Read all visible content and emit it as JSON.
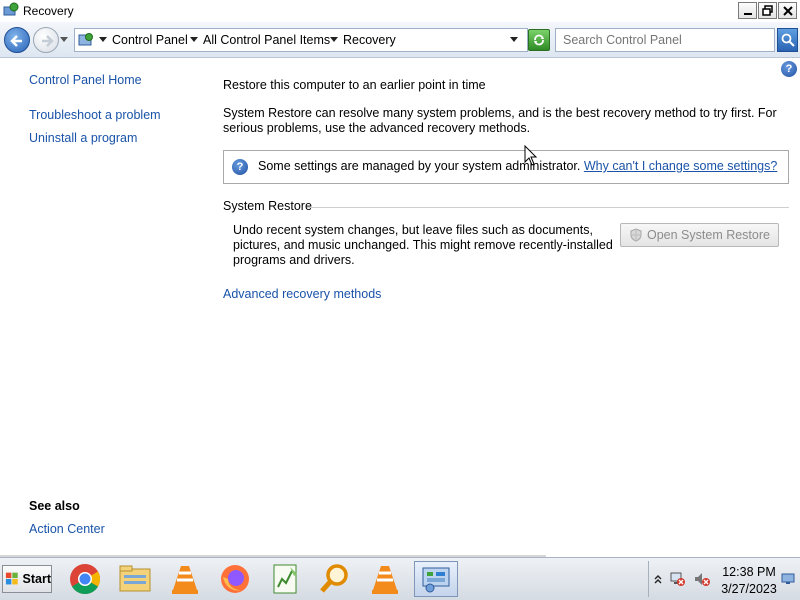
{
  "window": {
    "title": "Recovery",
    "min_glyph": "▁",
    "max_glyph": "❐",
    "close_glyph": "✕"
  },
  "address": {
    "crumbs": [
      "Control Panel",
      "All Control Panel Items",
      "Recovery"
    ],
    "search_placeholder": "Search Control Panel"
  },
  "sidebar": {
    "items": [
      {
        "label": "Control Panel Home"
      },
      {
        "label": "Troubleshoot a problem"
      },
      {
        "label": "Uninstall a program"
      }
    ],
    "see_also_title": "See also",
    "see_also_items": [
      {
        "label": "Action Center"
      }
    ]
  },
  "main": {
    "heading": "Restore this computer to an earlier point in time",
    "intro": "System Restore can resolve many system problems, and is the best recovery method to try first. For serious problems, use the advanced recovery methods.",
    "info_message": "Some settings are managed by your system administrator.",
    "info_link": "Why can't I change some settings?",
    "section_title": "System Restore",
    "restore_description": "Undo recent system changes, but leave files such as documents, pictures, and music unchanged. This might remove recently-installed programs and drivers.",
    "restore_button": "Open System Restore",
    "advanced_link": "Advanced recovery methods"
  },
  "taskbar": {
    "start_label": "Start",
    "apps": [
      {
        "icon": "chrome-icon"
      },
      {
        "icon": "file-explorer-icon"
      },
      {
        "icon": "vlc-icon"
      },
      {
        "icon": "firefox-icon"
      },
      {
        "icon": "spreadsheet-icon"
      },
      {
        "icon": "search-magnifier-icon"
      },
      {
        "icon": "vlc-icon"
      },
      {
        "icon": "control-panel-icon"
      }
    ],
    "time": "12:38 PM",
    "date": "3/27/2023"
  }
}
